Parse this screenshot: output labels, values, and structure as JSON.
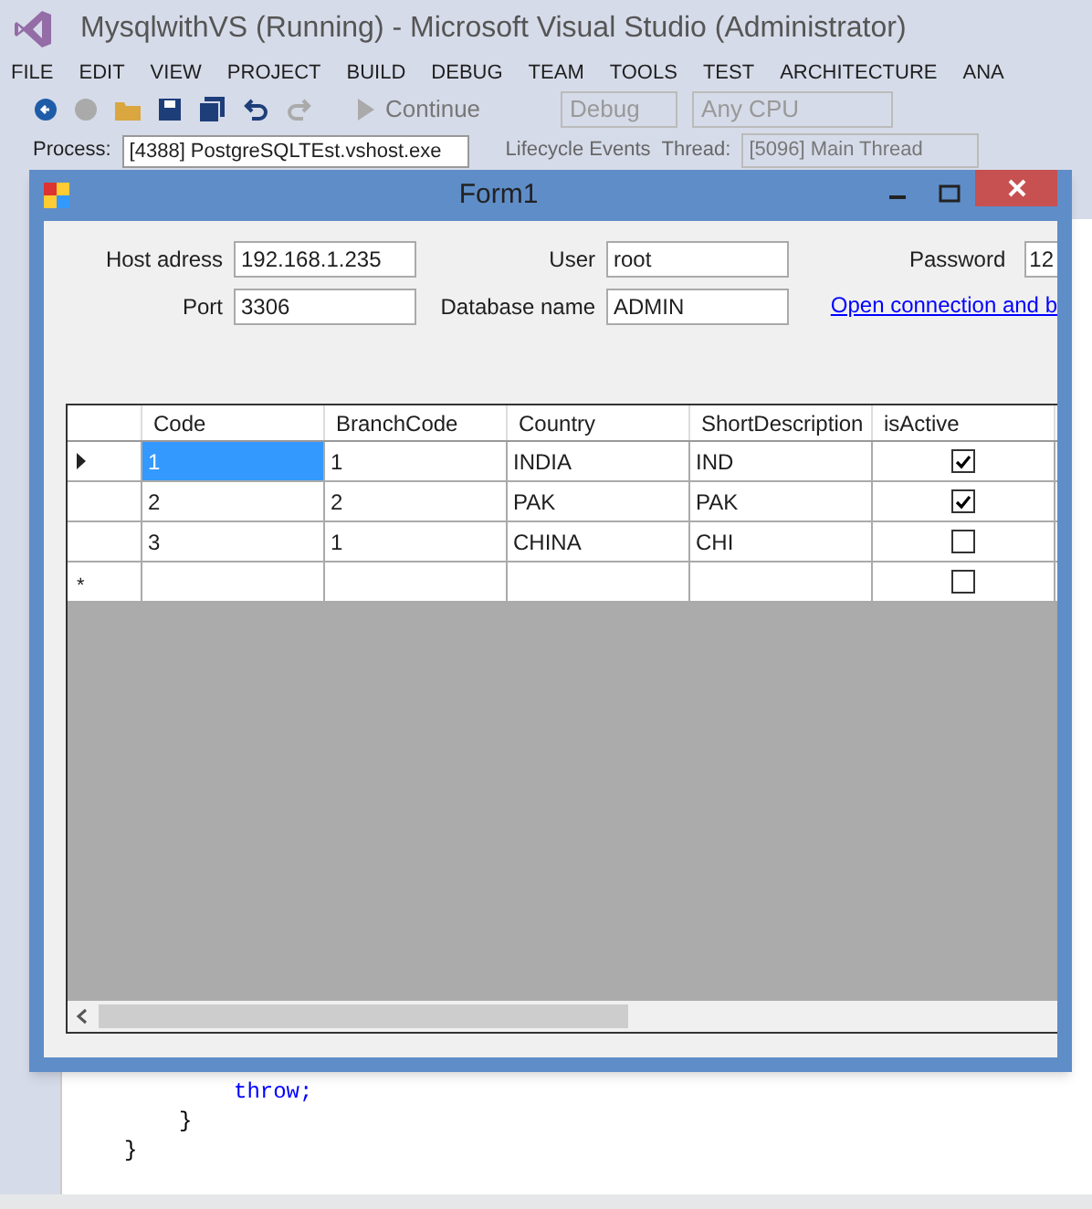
{
  "vs": {
    "title": "MysqlwithVS (Running) - Microsoft Visual Studio (Administrator)",
    "menu": [
      "FILE",
      "EDIT",
      "VIEW",
      "PROJECT",
      "BUILD",
      "DEBUG",
      "TEAM",
      "TOOLS",
      "TEST",
      "ARCHITECTURE",
      "ANA"
    ],
    "toolbar": {
      "continue": "Continue",
      "config": "Debug",
      "platform": "Any CPU"
    },
    "debug_bar": {
      "process_label": "Process:",
      "process": "[4388] PostgreSQLTEst.vshost.exe",
      "lifecycle": "Lifecycle Events",
      "thread_label": "Thread:",
      "thread": "[5096] Main Thread"
    },
    "code_lines": [
      {
        "text": "throw;",
        "kind": "keyword"
      },
      {
        "text": "}",
        "kind": "plain"
      },
      {
        "text": "}",
        "kind": "plain"
      }
    ]
  },
  "form": {
    "title": "Form1",
    "fields": [
      {
        "label": "Host adress",
        "value": "192.168.1.235"
      },
      {
        "label": "User",
        "value": "root"
      },
      {
        "label": "Password",
        "value": "12"
      },
      {
        "label": "Port",
        "value": "3306"
      },
      {
        "label": "Database name",
        "value": "ADMIN"
      }
    ],
    "link": "Open connection and b",
    "grid": {
      "columns": [
        "Code",
        "BranchCode",
        "Country",
        "ShortDescription",
        "isActive"
      ],
      "rows": [
        {
          "kind": "data",
          "selected": true,
          "cells": [
            "1",
            "1",
            "INDIA",
            "IND"
          ],
          "checked": true
        },
        {
          "kind": "data",
          "selected": false,
          "cells": [
            "2",
            "2",
            "PAK",
            "PAK"
          ],
          "checked": true
        },
        {
          "kind": "data",
          "selected": false,
          "cells": [
            "3",
            "1",
            "CHINA",
            "CHI"
          ],
          "checked": false
        },
        {
          "kind": "new",
          "selected": false,
          "marker": "*",
          "checked": false
        }
      ]
    }
  }
}
